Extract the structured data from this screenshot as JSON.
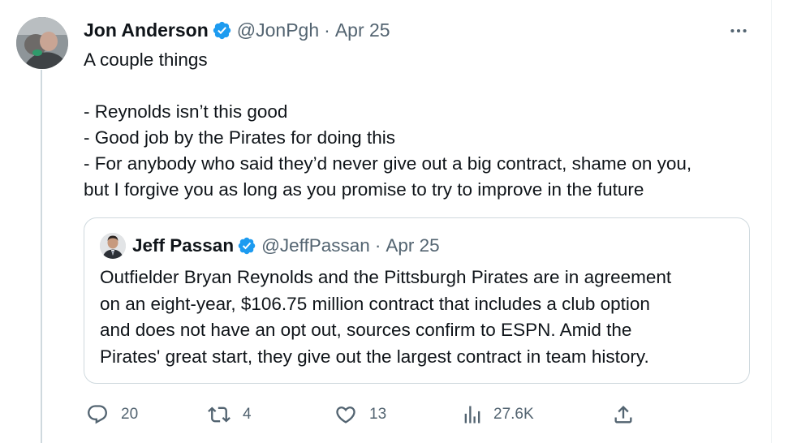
{
  "tweet": {
    "author_name": "Jon Anderson",
    "author_handle": "@JonPgh",
    "separator": "·",
    "date": "Apr 25",
    "body_lines": [
      "A couple things",
      "",
      "- Reynolds isn’t this good",
      "- Good job by the Pirates for doing this",
      "- For anybody who said they’d never give out a big contract, shame on you,",
      "but I forgive you as long as you promise to try to improve in the future"
    ]
  },
  "quoted_tweet": {
    "author_name": "Jeff Passan",
    "author_handle": "@JeffPassan",
    "separator": "·",
    "date": "Apr 25",
    "body_lines": [
      "Outfielder Bryan Reynolds and the Pittsburgh Pirates are in agreement",
      "on an eight-year, $106.75 million contract that includes a club option",
      "and does not have an opt out, sources confirm to ESPN. Amid the",
      "Pirates' great start, they give out the largest contract in team history."
    ]
  },
  "actions": {
    "reply_count": "20",
    "retweet_count": "4",
    "like_count": "13",
    "view_count": "27.6K"
  },
  "icons": {
    "more": "more-horizontal-icon",
    "verified": "verified-badge-icon",
    "reply": "reply-icon",
    "retweet": "retweet-icon",
    "like": "heart-icon",
    "views": "views-icon",
    "share": "share-icon"
  },
  "colors": {
    "text_primary": "#0f1419",
    "text_secondary": "#536471",
    "verified_blue": "#1d9bf0",
    "border": "#cfd9de"
  }
}
